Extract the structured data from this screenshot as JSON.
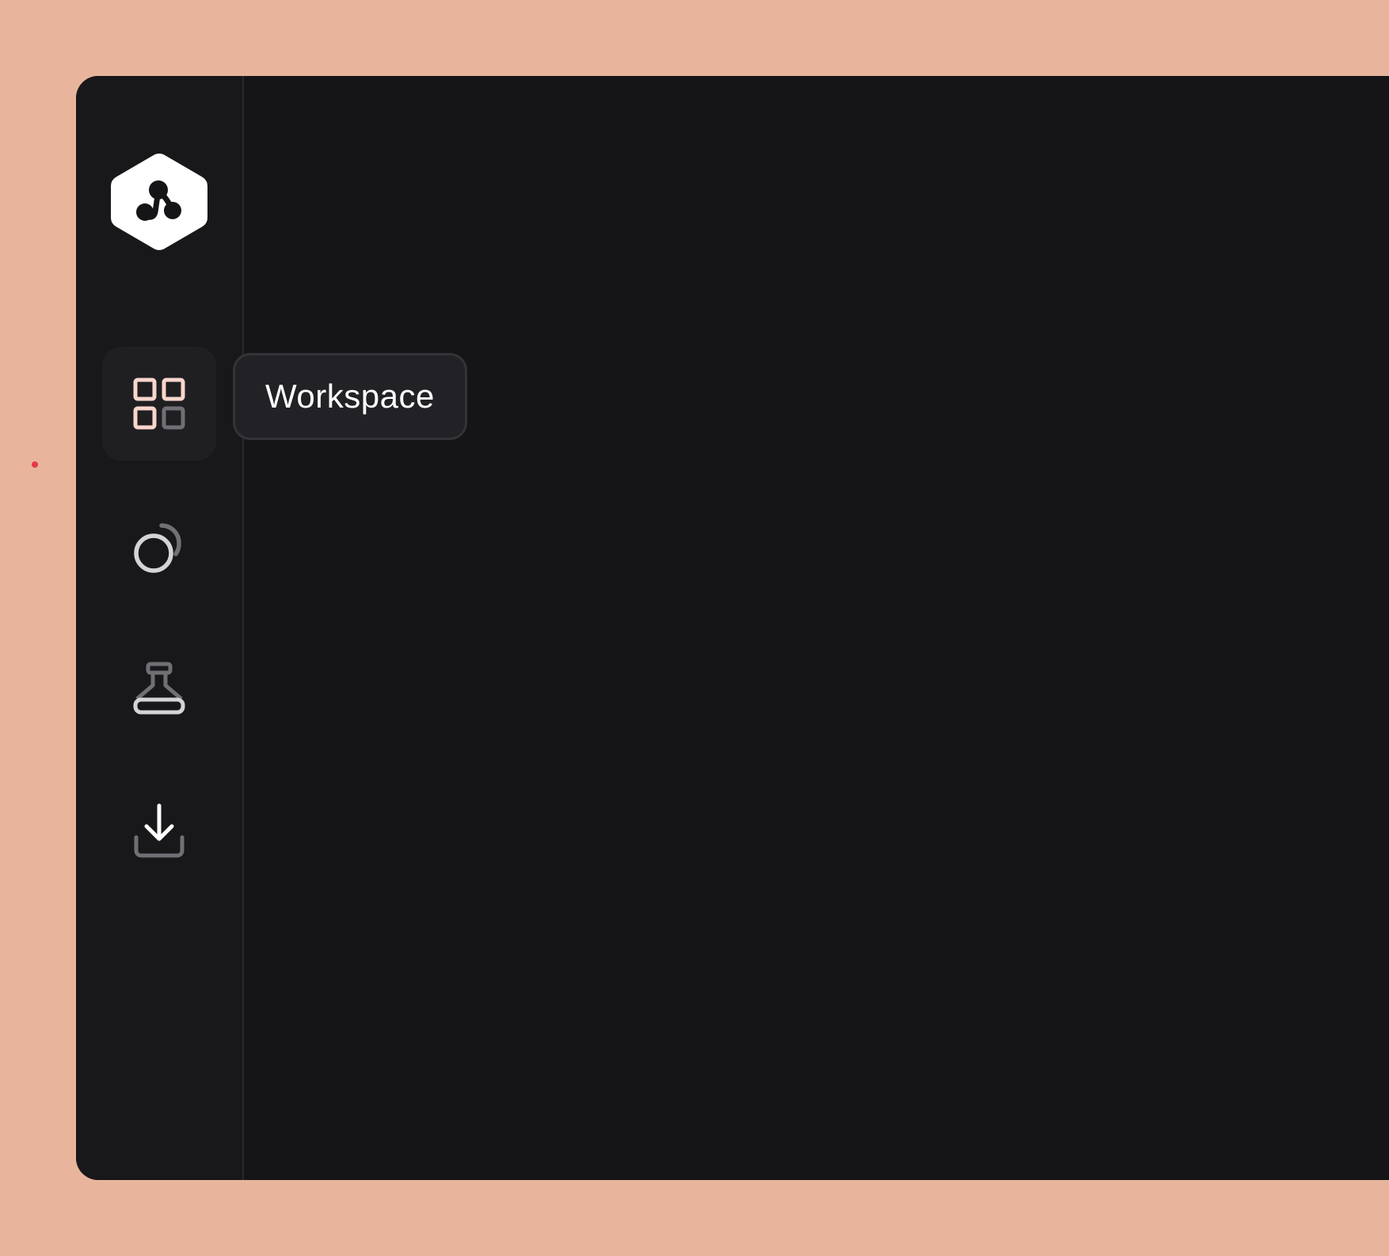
{
  "app": {
    "logo_icon": "hexagon-molecule-logo"
  },
  "sidebar": {
    "items": [
      {
        "id": "workspace",
        "icon": "grid-icon",
        "active": true
      },
      {
        "id": "loading",
        "icon": "orbit-icon",
        "active": false
      },
      {
        "id": "lab",
        "icon": "flask-icon",
        "active": false
      },
      {
        "id": "download",
        "icon": "download-icon",
        "active": false
      }
    ]
  },
  "tooltip": {
    "label": "Workspace"
  },
  "colors": {
    "background": "#e8b59c",
    "window": "#151517",
    "sidebar": "#18181a",
    "accent": "#f9d6cc",
    "icon_muted": "#6f6f75",
    "icon_light": "#d4d4d8",
    "cursor": "#e5394a"
  }
}
